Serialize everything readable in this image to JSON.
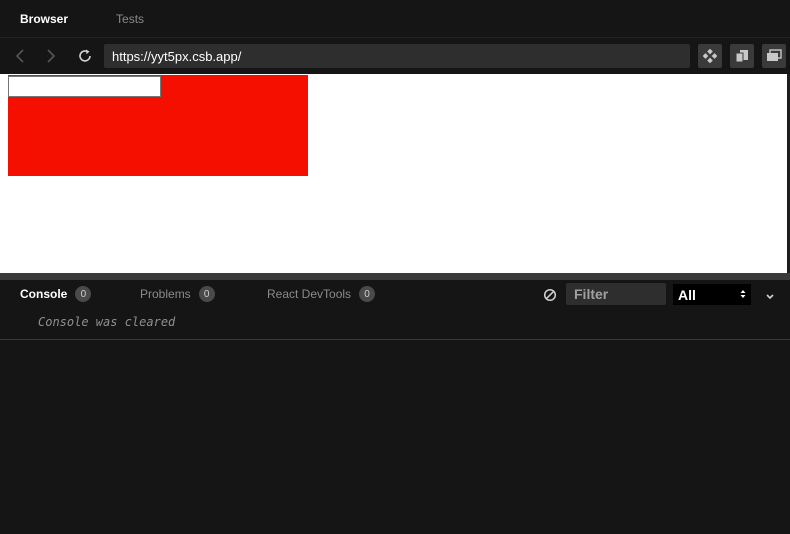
{
  "top_tabs": [
    {
      "label": "Browser",
      "active": true
    },
    {
      "label": "Tests",
      "active": false
    }
  ],
  "navigation": {
    "back_icon": "chevron-left-icon",
    "forward_icon": "chevron-right-icon",
    "refresh_icon": "refresh-icon",
    "url": "https://yyt5px.csb.app/",
    "tool_icons": [
      "move-icon",
      "copy-window-icon",
      "open-window-icon"
    ]
  },
  "preview": {
    "box_color": "#f50f00"
  },
  "devtools": {
    "tabs": [
      {
        "label": "Console",
        "count": "0",
        "active": true
      },
      {
        "label": "Problems",
        "count": "0",
        "active": false
      },
      {
        "label": "React DevTools",
        "count": "0",
        "active": false
      }
    ],
    "clear_icon": "clear-console-icon",
    "filter_placeholder": "Filter",
    "level": "All",
    "collapse_icon": "chevron-down-icon"
  },
  "console": {
    "message": "Console was cleared"
  }
}
